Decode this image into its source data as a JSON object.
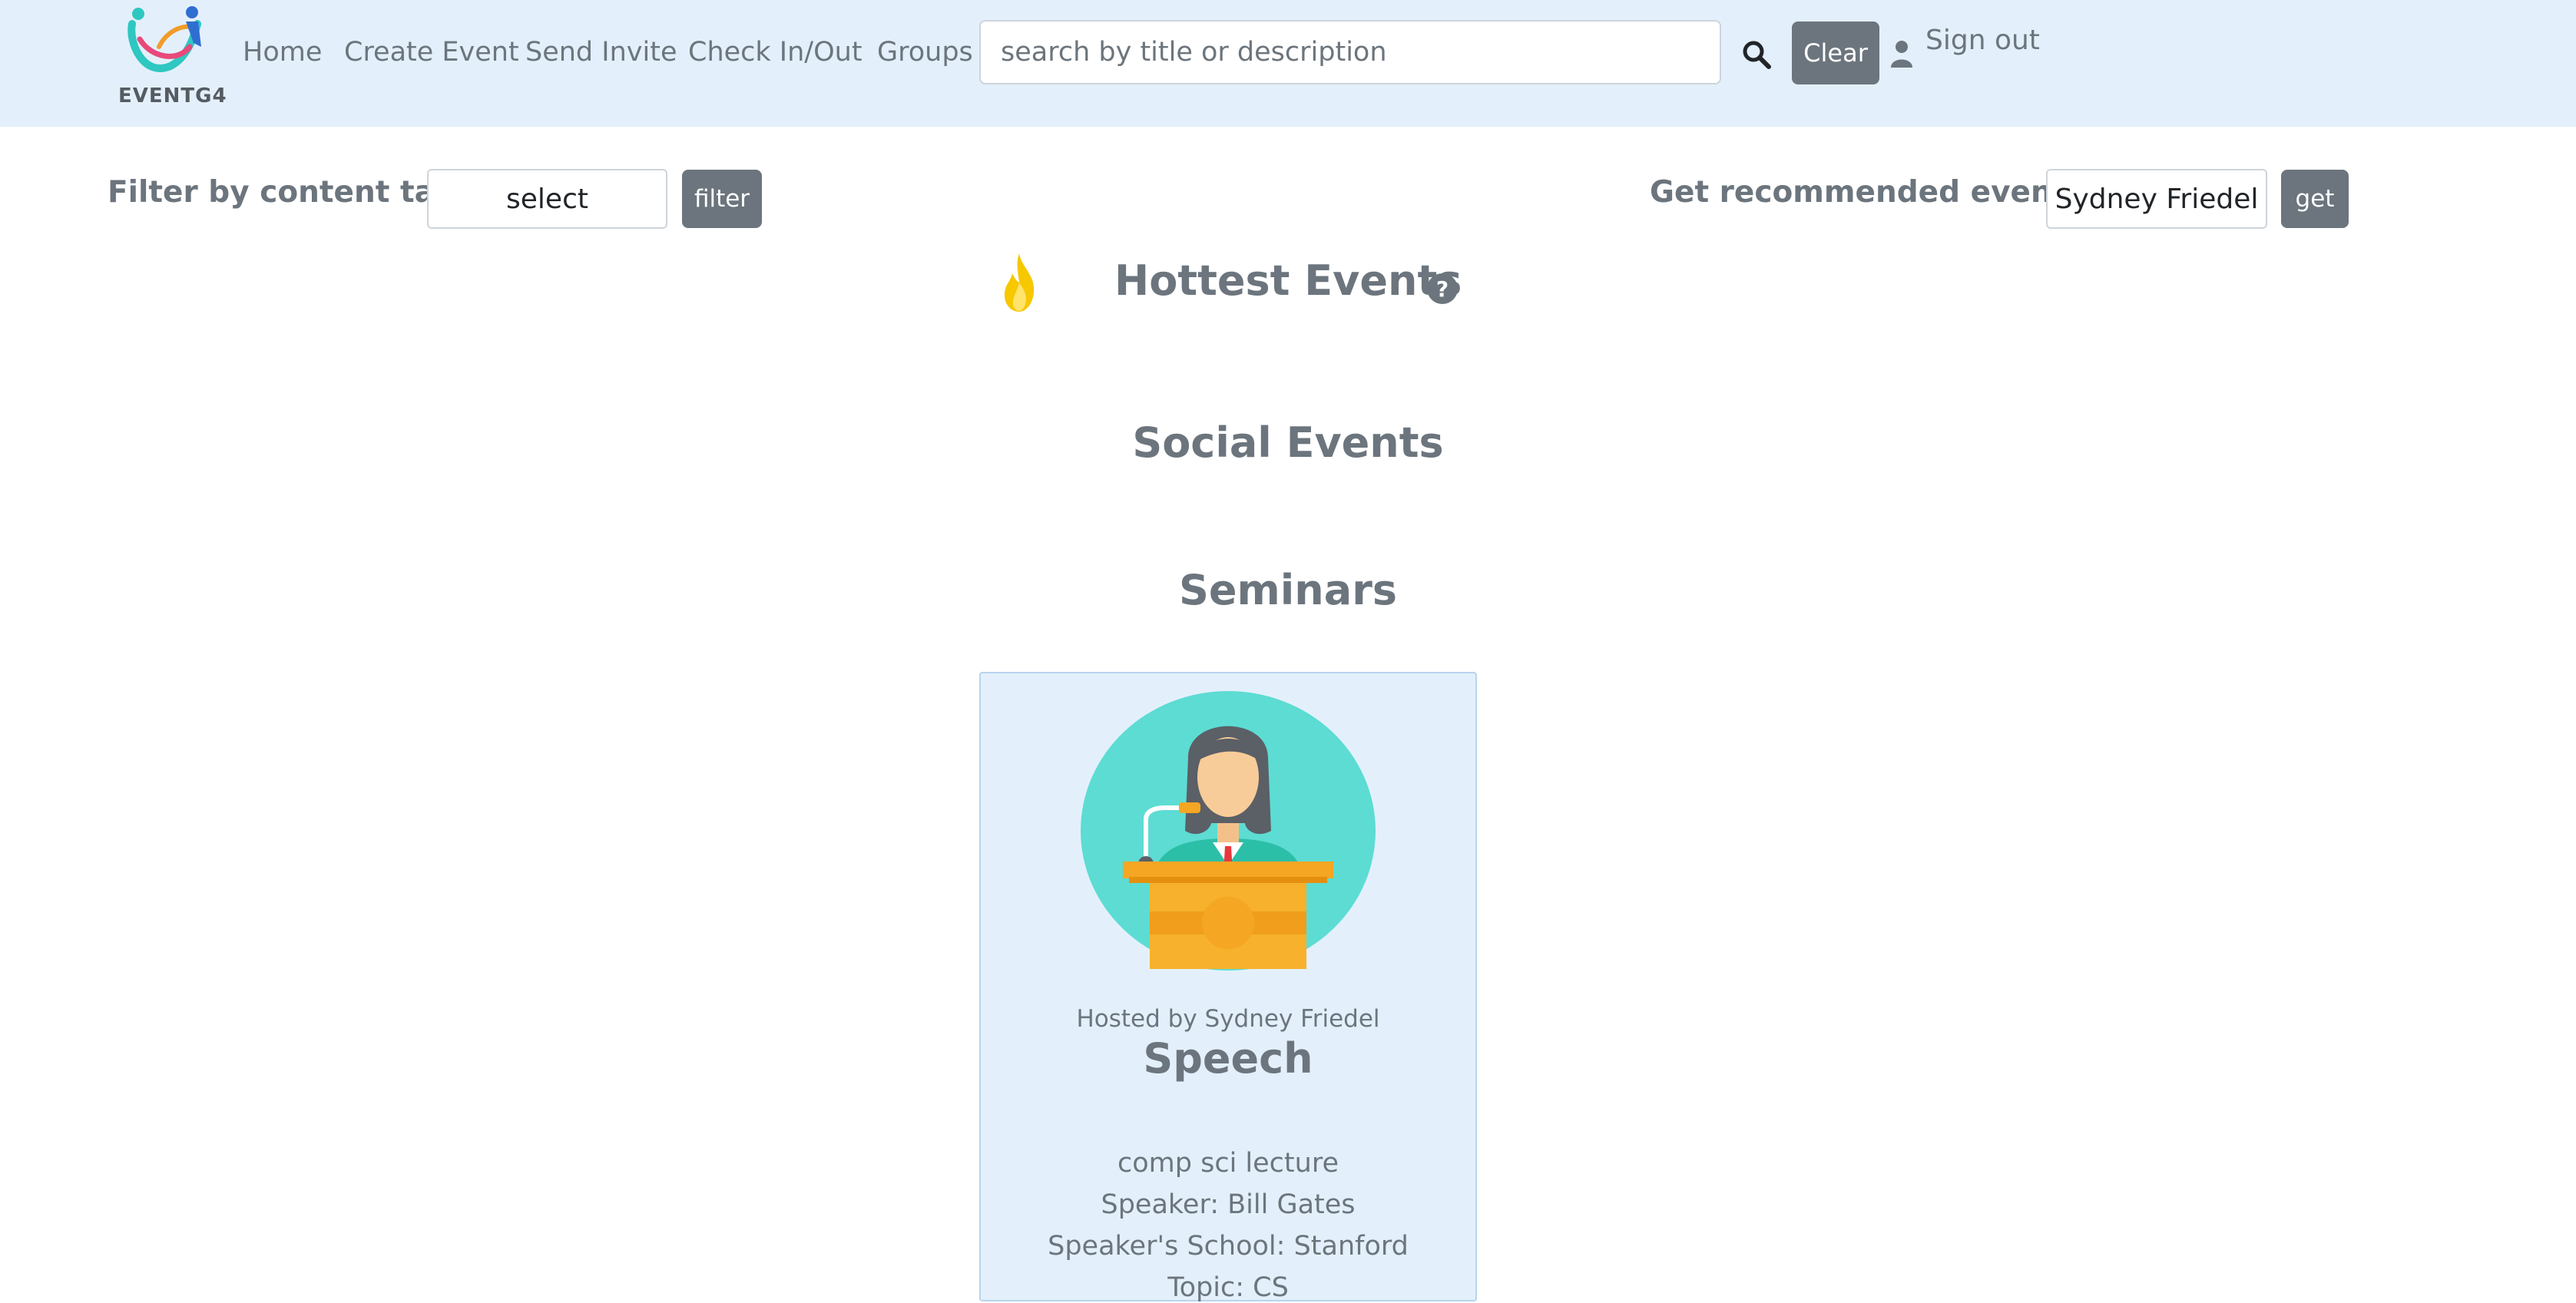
{
  "brand": {
    "name": "EVENTG4"
  },
  "nav": {
    "links": [
      "Home",
      "Create Event",
      "Send Invite",
      "Check In/Out",
      "Groups"
    ],
    "search_placeholder": "search by title or description",
    "clear_label": "Clear",
    "signout_label": "Sign out"
  },
  "filter": {
    "label": "Filter by content tag:",
    "select_value": "select",
    "button_label": "filter"
  },
  "recommend": {
    "label": "Get recommended events:",
    "select_value": "Sydney Friedel",
    "button_label": "get"
  },
  "sections": {
    "hottest": "Hottest Events",
    "social": "Social Events",
    "seminars": "Seminars"
  },
  "card": {
    "host": "Hosted by Sydney Friedel",
    "title": "Speech",
    "description": "comp sci lecture",
    "speaker": "Speaker: Bill Gates",
    "school": "Speaker's School: Stanford",
    "topic": "Topic: CS"
  },
  "colors": {
    "navbar_bg": "#e3f0fb",
    "button_gray": "#6c757d",
    "card_bg": "#e3f0fb",
    "text_gray": "#6c757d"
  }
}
